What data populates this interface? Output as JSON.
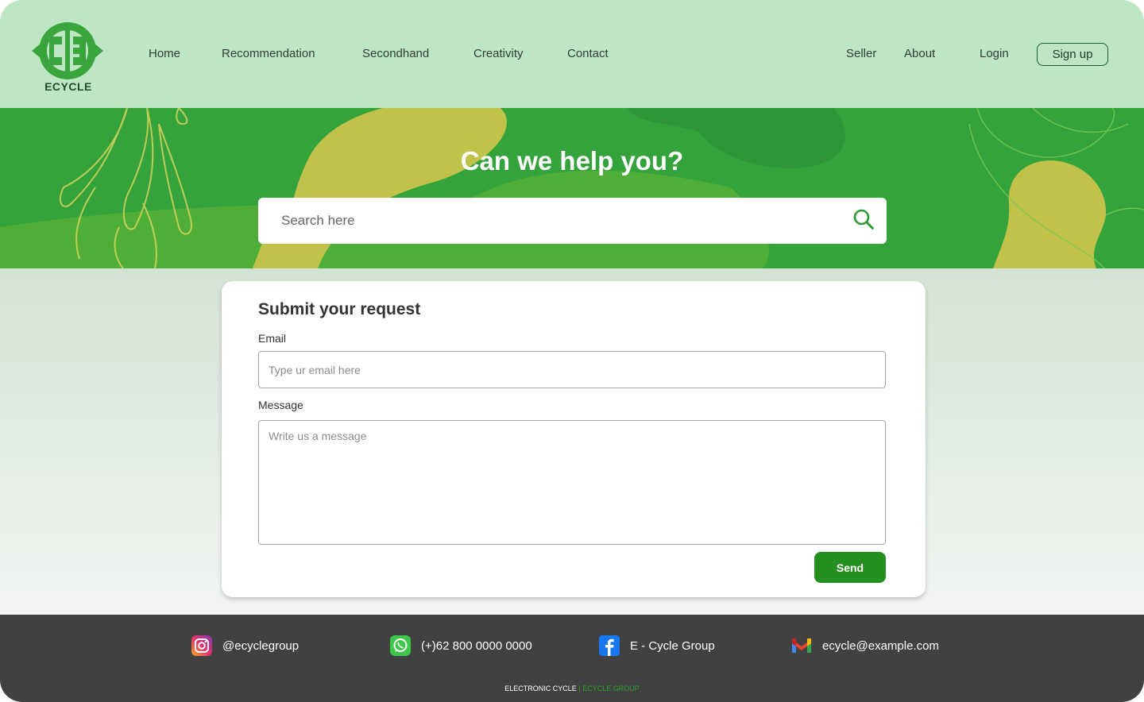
{
  "brand": {
    "logo_text": "ECYCLE",
    "logo_icon": "recycle-e-logo",
    "primary_color": "#35a33c"
  },
  "nav": {
    "left": [
      "Home",
      "Recommendation",
      "Secondhand",
      "Creativity",
      "Contact"
    ],
    "right": [
      "Seller",
      "About",
      "Login"
    ],
    "signup": "Sign up"
  },
  "hero": {
    "title": "Can we help you?",
    "search_placeholder": "Search here",
    "search_icon": "search-icon"
  },
  "form": {
    "title": "Submit your request",
    "email_label": "Email",
    "email_placeholder": "Type ur email here",
    "message_label": "Message",
    "message_placeholder": "Write us a message",
    "send_label": "Send",
    "send_color": "#25901f"
  },
  "footer": {
    "socials": [
      {
        "icon": "instagram-icon",
        "text": "@ecyclegroup"
      },
      {
        "icon": "whatsapp-icon",
        "text": "(+)62 800 0000 0000"
      },
      {
        "icon": "facebook-icon",
        "text": "E - Cycle Group"
      },
      {
        "icon": "gmail-icon",
        "text": "ecycle@example.com"
      }
    ],
    "copyright_left": "ELECTRONIC CYCLE",
    "copyright_sep": "|",
    "copyright_right": "ECYCLE GROUP"
  }
}
